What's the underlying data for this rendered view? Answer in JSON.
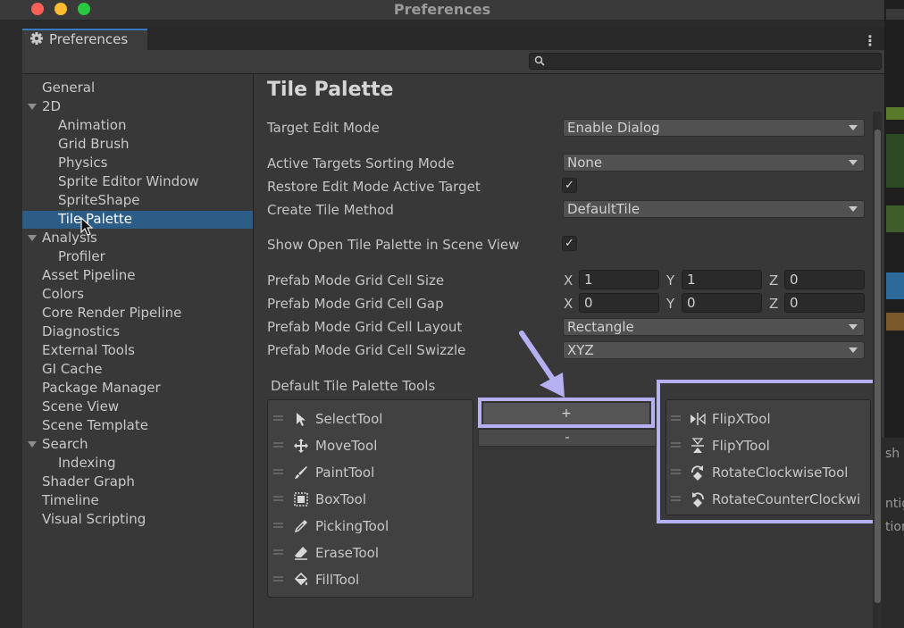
{
  "window": {
    "title": "Preferences",
    "tab_label": "Preferences"
  },
  "sidebar": {
    "items": [
      {
        "label": "General",
        "level": 0
      },
      {
        "label": "2D",
        "level": 0,
        "expanded": true
      },
      {
        "label": "Animation",
        "level": 1
      },
      {
        "label": "Grid Brush",
        "level": 1
      },
      {
        "label": "Physics",
        "level": 1
      },
      {
        "label": "Sprite Editor Window",
        "level": 1
      },
      {
        "label": "SpriteShape",
        "level": 1
      },
      {
        "label": "Tile Palette",
        "level": 1,
        "selected": true
      },
      {
        "label": "Analysis",
        "level": 0,
        "expanded": true
      },
      {
        "label": "Profiler",
        "level": 1
      },
      {
        "label": "Asset Pipeline",
        "level": 0
      },
      {
        "label": "Colors",
        "level": 0
      },
      {
        "label": "Core Render Pipeline",
        "level": 0
      },
      {
        "label": "Diagnostics",
        "level": 0
      },
      {
        "label": "External Tools",
        "level": 0
      },
      {
        "label": "GI Cache",
        "level": 0
      },
      {
        "label": "Package Manager",
        "level": 0
      },
      {
        "label": "Scene View",
        "level": 0
      },
      {
        "label": "Scene Template",
        "level": 0
      },
      {
        "label": "Search",
        "level": 0,
        "expanded": true
      },
      {
        "label": "Indexing",
        "level": 1
      },
      {
        "label": "Shader Graph",
        "level": 0
      },
      {
        "label": "Timeline",
        "level": 0
      },
      {
        "label": "Visual Scripting",
        "level": 0
      }
    ]
  },
  "main": {
    "title": "Tile Palette",
    "target_edit_mode": {
      "label": "Target Edit Mode",
      "value": "Enable Dialog"
    },
    "sorting_mode": {
      "label": "Active Targets Sorting Mode",
      "value": "None"
    },
    "restore_edit": {
      "label": "Restore Edit Mode Active Target",
      "checked": true
    },
    "create_tile_method": {
      "label": "Create Tile Method",
      "value": "DefaultTile"
    },
    "show_open": {
      "label": "Show Open Tile Palette in Scene View",
      "checked": true
    },
    "cell_size": {
      "label": "Prefab Mode Grid Cell Size",
      "x": "1",
      "y": "1",
      "z": "0"
    },
    "cell_gap": {
      "label": "Prefab Mode Grid Cell Gap",
      "x": "0",
      "y": "0",
      "z": "0"
    },
    "cell_layout": {
      "label": "Prefab Mode Grid Cell Layout",
      "value": "Rectangle"
    },
    "cell_swizzle": {
      "label": "Prefab Mode Grid Cell Swizzle",
      "value": "XYZ"
    },
    "axes": {
      "x": "X",
      "y": "Y",
      "z": "Z"
    },
    "tools_label": "Default Tile Palette Tools",
    "check_glyph": "✓",
    "add_label": "+",
    "remove_label": "-",
    "active_tools": [
      {
        "label": "SelectTool",
        "icon": "select-arrow-icon"
      },
      {
        "label": "MoveTool",
        "icon": "move-icon"
      },
      {
        "label": "PaintTool",
        "icon": "paint-brush-icon"
      },
      {
        "label": "BoxTool",
        "icon": "box-fill-icon"
      },
      {
        "label": "PickingTool",
        "icon": "picker-icon"
      },
      {
        "label": "EraseTool",
        "icon": "eraser-icon"
      },
      {
        "label": "FillTool",
        "icon": "fill-bucket-icon"
      }
    ],
    "available_tools": [
      {
        "label": "FlipXTool",
        "icon": "flip-x-icon"
      },
      {
        "label": "FlipYTool",
        "icon": "flip-y-icon"
      },
      {
        "label": "RotateClockwiseTool",
        "icon": "rotate-cw-icon"
      },
      {
        "label": "RotateCounterClockwi",
        "icon": "rotate-ccw-icon"
      }
    ]
  },
  "right_panel": {
    "fragments": [
      "sh",
      "ntig",
      "tion"
    ]
  },
  "colors": {
    "highlight": "#b4b0f2",
    "selected": "#2c5d87",
    "accent": "#3a79bb"
  }
}
